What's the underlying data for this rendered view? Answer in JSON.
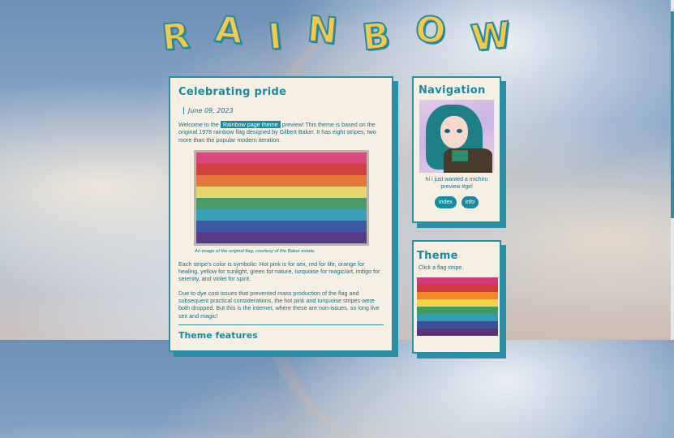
{
  "header": {
    "title_letters": [
      "R",
      "A",
      "I",
      "N",
      "B",
      "O",
      "W"
    ]
  },
  "post": {
    "title": "Celebrating pride",
    "date": "June 09, 2023",
    "intro_before": "Welcome to the ",
    "intro_link": "Rainbow page theme",
    "intro_after": " preview! This theme is based on the original 1978 rainbow flag designed by Gilbert Baker. It has eight stripes, two more than the popular modern iteration.",
    "caption": "An image of the original flag, courtesy of the Baker estate.",
    "para2": "Each stripe's color is symbolic: Hot pink is for sex, red for life, orange for healing, yellow for sunlight, green for nature, turquoise for magic/art, indigo for serenity, and violet for spirit.",
    "para3": "Due to dye cost issues that prevented mass production of the flag and subsequent practical considerations, the hot pink and turquoise stripes were both dropped. But this is the internet, where these are non-issues, so long live sex and magic!",
    "next_heading": "Theme features",
    "flag_colors": [
      "#d9477f",
      "#d2403f",
      "#e2763b",
      "#e8d56a",
      "#4a9a6a",
      "#3aa0b8",
      "#3b5aa2",
      "#5a3a88"
    ]
  },
  "nav": {
    "title": "Navigation",
    "caption": "hi i just wanted a michiru preview #girl",
    "buttons": [
      "index",
      "info"
    ]
  },
  "theme": {
    "title": "Theme",
    "subtitle": "Click a flag stripe.",
    "stripe_colors": [
      "#d23a79",
      "#d5393a",
      "#ef8a2c",
      "#f2d34a",
      "#3e9a63",
      "#2f9fb4",
      "#3d4f9b",
      "#5b2f7a"
    ]
  }
}
